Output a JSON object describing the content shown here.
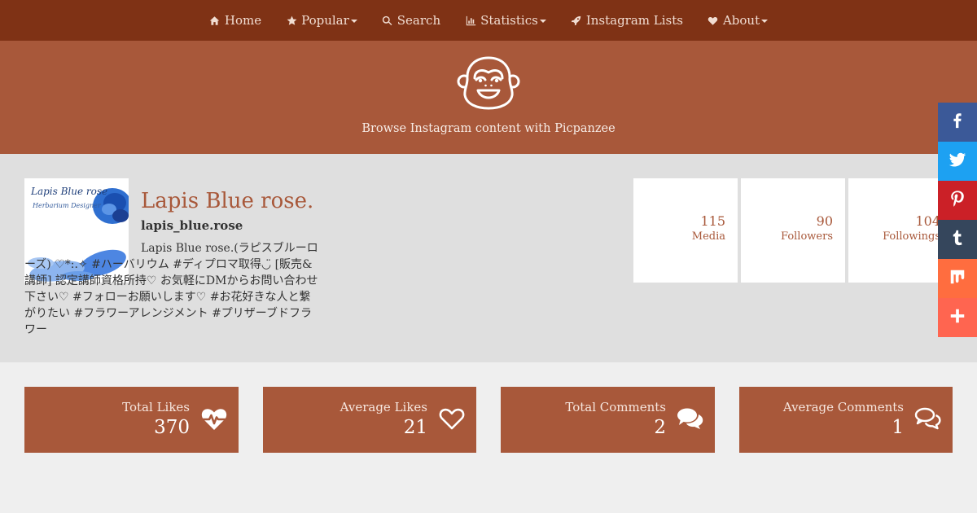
{
  "nav": {
    "items": [
      {
        "label": "Home",
        "icon": "home-icon",
        "dropdown": false
      },
      {
        "label": "Popular",
        "icon": "star-icon",
        "dropdown": true
      },
      {
        "label": "Search",
        "icon": "search-icon",
        "dropdown": false
      },
      {
        "label": "Statistics",
        "icon": "bar-chart-icon",
        "dropdown": true
      },
      {
        "label": "Instagram Lists",
        "icon": "rocket-icon",
        "dropdown": false
      },
      {
        "label": "About",
        "icon": "heart-icon",
        "dropdown": true
      }
    ]
  },
  "hero": {
    "tagline": "Browse Instagram content with Picpanzee"
  },
  "profile": {
    "display_name": "Lapis Blue rose.",
    "username": "lapis_blue.rose",
    "bio": "Lapis Blue rose.(ラピスブルーローズ) ♡*:.✧ #ハーバリウム #ディプロマ取得◡̈ [販売&講師] 認定講師資格所持♡ お気軽にDMからお問い合わせ下さい♡ #フォローお願いします♡ #お花好きな人と繋がりたい #フラワーアレンジメント #プリザーブドフラワー",
    "avatar": {
      "line1": "Lapis Blue rose",
      "line2": "Herbarium Designer"
    },
    "stats": {
      "media": {
        "value": "115",
        "label": "Media"
      },
      "followers": {
        "value": "90",
        "label": "Followers"
      },
      "followings": {
        "value": "104",
        "label": "Followings"
      }
    }
  },
  "share": [
    "facebook-icon",
    "twitter-icon",
    "pinterest-icon",
    "tumblr-icon",
    "mix-icon",
    "plus-icon"
  ],
  "metrics": [
    {
      "label": "Total Likes",
      "value": "370",
      "icon": "heartbeat-icon"
    },
    {
      "label": "Average Likes",
      "value": "21",
      "icon": "heart-outline-icon"
    },
    {
      "label": "Total Comments",
      "value": "2",
      "icon": "comments-icon"
    },
    {
      "label": "Average Comments",
      "value": "1",
      "icon": "comments-outline-icon"
    }
  ],
  "colors": {
    "nav_bg": "#7f3215",
    "accent": "#a8583a",
    "profile_bg": "#dfdfdf",
    "page_bg": "#efefef",
    "facebook": "#3b5998",
    "twitter": "#1da1f2",
    "pinterest": "#cb2027",
    "tumblr": "#35465c",
    "mix": "#ff6d3f",
    "plus": "#ff6550"
  }
}
